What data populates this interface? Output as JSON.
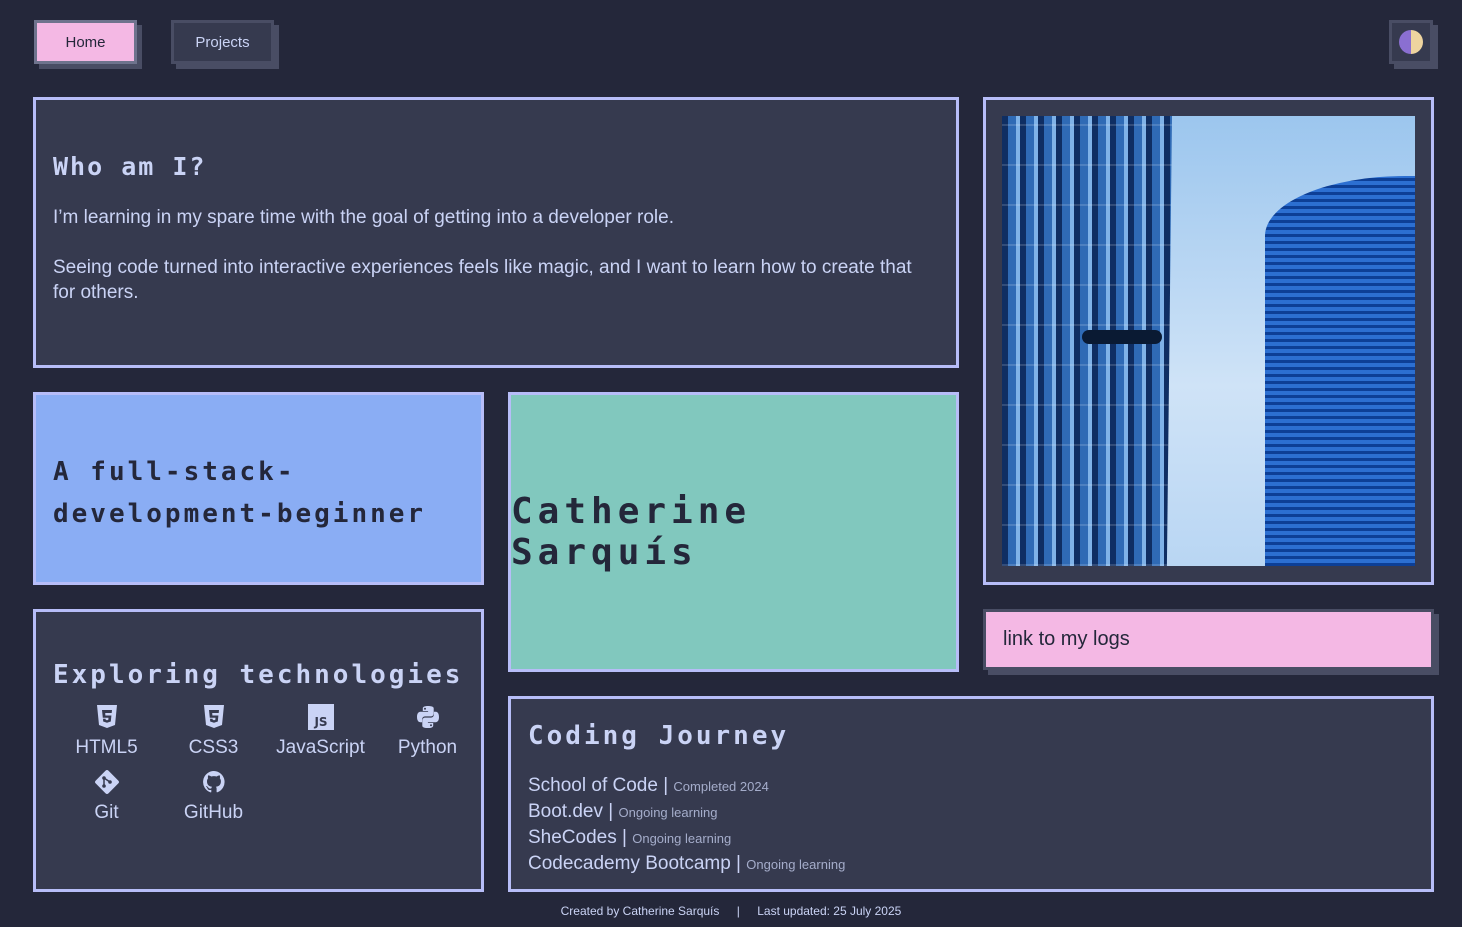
{
  "nav": {
    "home_label": "Home",
    "projects_label": "Projects",
    "theme_icon": "half-moon-theme-icon"
  },
  "about": {
    "title": "Who am I?",
    "paragraphs": [
      "I’m learning in my spare time with the goal of getting into a developer role.",
      "Seeing code turned into interactive experiences feels like magic, and I want to learn how to create that for others."
    ]
  },
  "tagline": {
    "line1": "A full-stack-",
    "line2": "development-beginner"
  },
  "name": "Catherine Sarquís",
  "photo": {
    "icon": "building-photo"
  },
  "logs_link": "link to my logs",
  "technologies": {
    "title": "Exploring technologies",
    "items": [
      {
        "label": "HTML5",
        "icon": "html5-icon"
      },
      {
        "label": "CSS3",
        "icon": "css3-icon"
      },
      {
        "label": "JavaScript",
        "icon": "javascript-icon"
      },
      {
        "label": "Python",
        "icon": "python-icon"
      },
      {
        "label": "Git",
        "icon": "git-icon"
      },
      {
        "label": "GitHub",
        "icon": "github-icon"
      }
    ]
  },
  "journey": {
    "title": "Coding Journey",
    "items": [
      {
        "name": "School of Code",
        "status": "Completed 2024"
      },
      {
        "name": "Boot.dev",
        "status": "Ongoing learning"
      },
      {
        "name": "SheCodes",
        "status": "Ongoing learning"
      },
      {
        "name": "Codecademy Bootcamp",
        "status": "Ongoing learning"
      }
    ]
  },
  "footer": {
    "created": "Created by Catherine Sarquís",
    "separator": "|",
    "updated": "Last updated: 25 July 2025"
  },
  "colors": {
    "background": "#24273a",
    "card": "#363a4f",
    "border": "#b7bdf8",
    "pink": "#f4b8e4",
    "blue": "#8aadf4",
    "teal": "#81c8be"
  }
}
